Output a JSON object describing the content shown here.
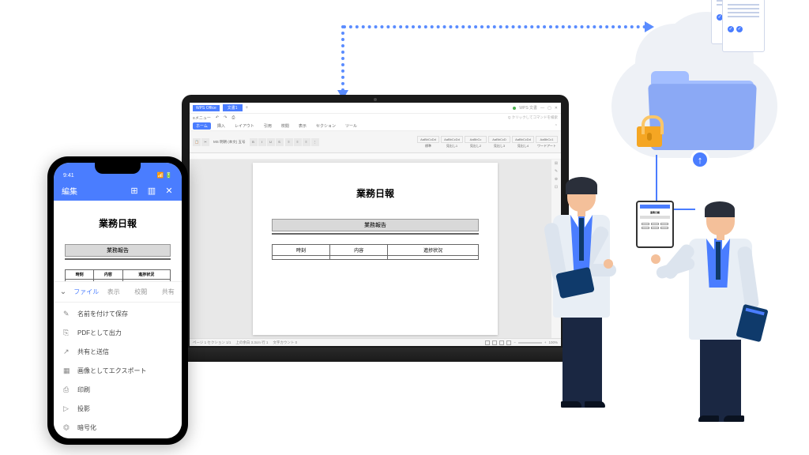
{
  "laptop": {
    "app_name": "WPS Office",
    "tab_title": "文書1",
    "status_label": "WPS 文書",
    "menu": [
      "≡メニュー",
      "↶",
      "↷",
      "⎙"
    ],
    "search_hint": "Q クリックしてコマンドを検索",
    "ribbon_sub": "MS 明朝 (本文)  五号",
    "tabs": [
      "ホーム",
      "挿入",
      "レイアウト",
      "引用",
      "校閲",
      "表示",
      "セクション",
      "ツール"
    ],
    "styles": [
      {
        "preview": "AaBbCcDd",
        "name": "標準"
      },
      {
        "preview": "AaBbCcDd",
        "name": "見出し1"
      },
      {
        "preview": "AaBbCc",
        "name": "見出し2"
      },
      {
        "preview": "AaBbCcD",
        "name": "見出し3"
      },
      {
        "preview": "AaBbCcDd",
        "name": "見出し4"
      },
      {
        "preview": "AaBbCc1",
        "name": "ワードアート"
      }
    ],
    "document": {
      "title": "業務日報",
      "section": "業務報告",
      "columns": [
        "時刻",
        "内容",
        "進捗状況"
      ]
    },
    "statusbar": {
      "page": "ページ 1  セクション 1/1",
      "pos": "上の余白 3.3cm  行 1",
      "wc": "文字カウント 0",
      "zoom": "100%"
    }
  },
  "phone": {
    "time": "9:41",
    "header": "編集",
    "doc_title": "業務日報",
    "section": "業務報告",
    "columns": [
      "時刻",
      "内容",
      "進捗状況"
    ],
    "menu_tabs": [
      "ファイル",
      "表示",
      "校閲",
      "共有"
    ],
    "menu_items": [
      {
        "icon": "✎",
        "label": "名前を付けて保存"
      },
      {
        "icon": "⎘",
        "label": "PDFとして出力"
      },
      {
        "icon": "↗",
        "label": "共有と送信"
      },
      {
        "icon": "▦",
        "label": "画像としてエクスポート"
      },
      {
        "icon": "⎙",
        "label": "印刷"
      },
      {
        "icon": "▷",
        "label": "投影"
      },
      {
        "icon": "⏣",
        "label": "暗号化"
      }
    ]
  },
  "mini_tablet": {
    "title": "業務日報"
  }
}
